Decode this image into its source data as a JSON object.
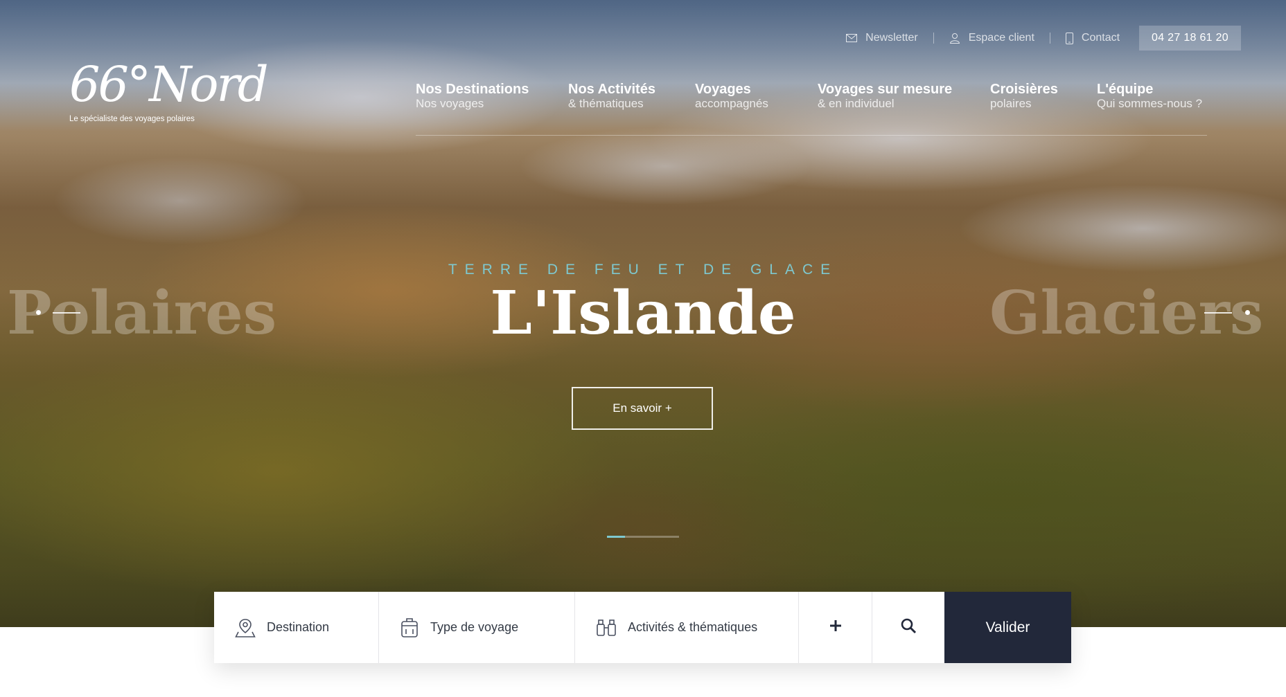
{
  "brand": {
    "logo_text": "66°Nord",
    "tagline": "Le spécialiste des voyages polaires"
  },
  "utility": {
    "newsletter": "Newsletter",
    "account": "Espace client",
    "contact": "Contact",
    "phone": "04 27 18 61 20"
  },
  "nav": [
    {
      "title": "Nos Destinations",
      "subtitle": "Nos voyages"
    },
    {
      "title": "Nos Activités",
      "subtitle": "& thématiques"
    },
    {
      "title": "Voyages",
      "subtitle": "accompagnés"
    },
    {
      "title": "Voyages sur mesure",
      "subtitle": "& en individuel"
    },
    {
      "title": "Croisières",
      "subtitle": "polaires"
    },
    {
      "title": "L'équipe",
      "subtitle": "Qui sommes-nous ?"
    }
  ],
  "slider": {
    "kicker": "TERRE DE FEU ET DE GLACE",
    "title": "L'Islande",
    "prev_title": "Polaires",
    "next_title": "Glaciers du",
    "cta": "En savoir +",
    "progress": 0.25
  },
  "search": {
    "destination": "Destination",
    "type": "Type de voyage",
    "activities": "Activités & thématiques",
    "submit": "Valider"
  },
  "colors": {
    "accent": "#7ec8cf",
    "navy": "#22283a"
  }
}
